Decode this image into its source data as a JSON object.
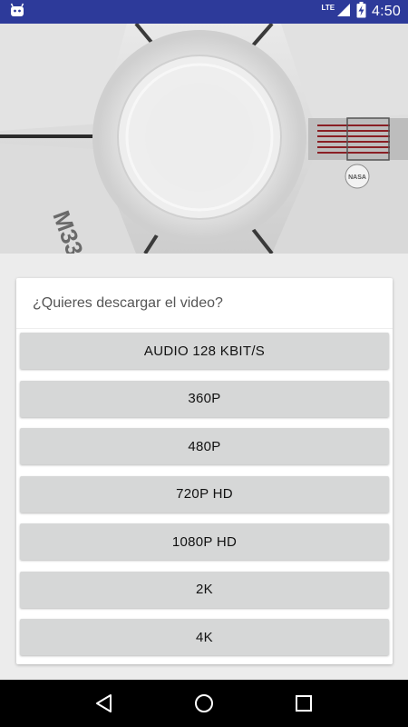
{
  "status_bar": {
    "time": "4:50",
    "network": "LTE",
    "app_icon": "android-icon",
    "signal_icon": "signal-icon",
    "battery_icon": "battery-charging-icon"
  },
  "hero": {
    "logo_text": "M33",
    "badge_text": "NASA"
  },
  "dialog": {
    "title": "¿Quieres descargar el video?",
    "options": [
      {
        "label": "AUDIO 128 KBIT/S"
      },
      {
        "label": "360P"
      },
      {
        "label": "480P"
      },
      {
        "label": "720P HD"
      },
      {
        "label": "1080P HD"
      },
      {
        "label": "2K"
      },
      {
        "label": "4K"
      }
    ]
  },
  "nav_bar": {
    "back_icon": "back-icon",
    "home_icon": "home-icon",
    "recents_icon": "recents-icon"
  },
  "colors": {
    "status_bar": "#2d3a9a",
    "button": "#d6d7d7",
    "card": "#ffffff",
    "background": "#ececec",
    "nav_bar": "#000000"
  }
}
